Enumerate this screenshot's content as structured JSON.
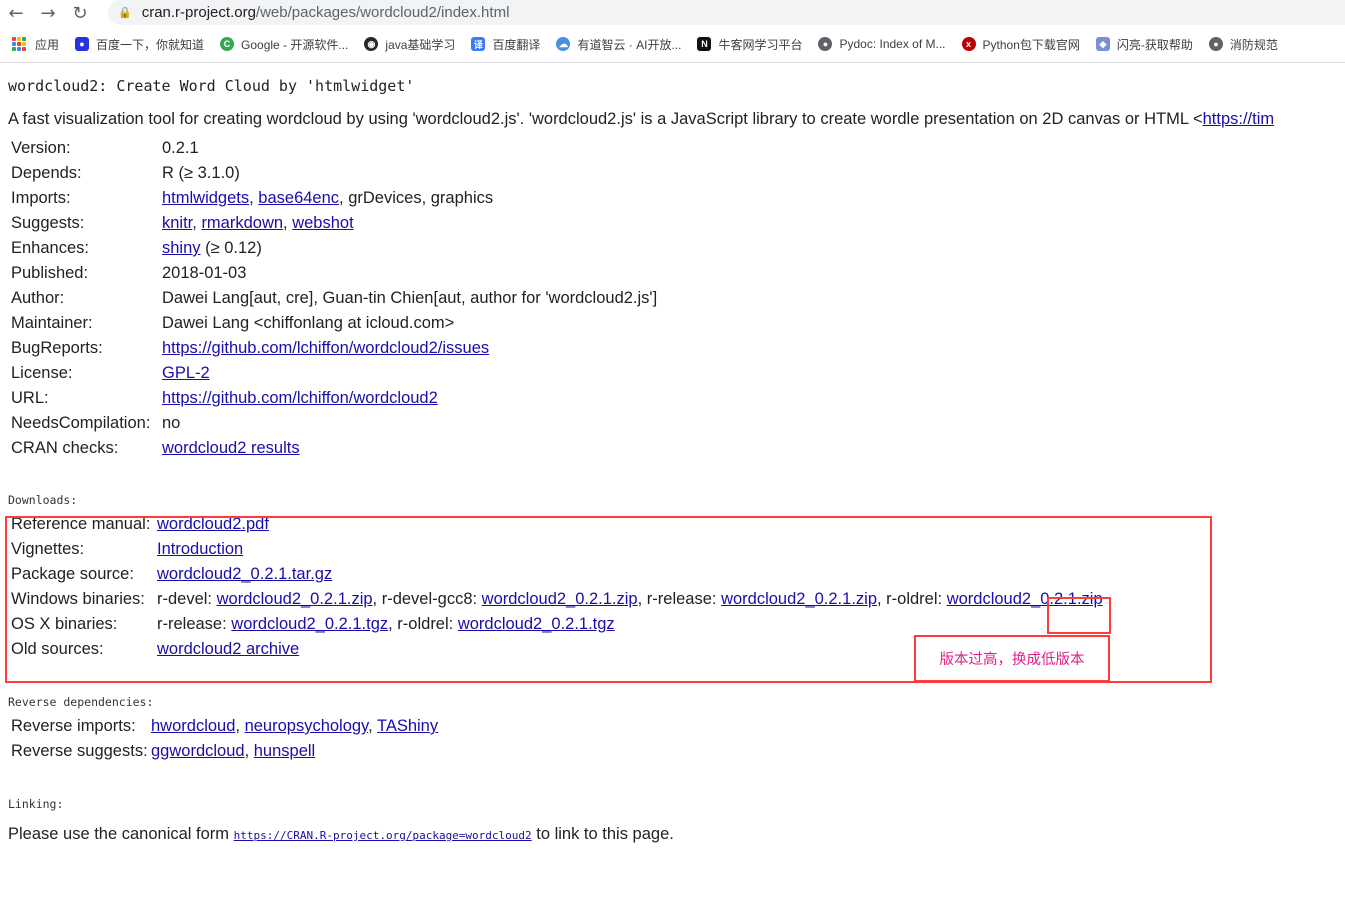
{
  "browser": {
    "url_host": "cran.r-project.org",
    "url_path": "/web/packages/wordcloud2/index.html",
    "bookmarks": [
      {
        "label": "应用",
        "icon": "apps-grid-icon"
      },
      {
        "label": "百度一下，你就知道",
        "icon": "baidu-paw-icon",
        "color": "#2932e1"
      },
      {
        "label": "Google - 开源软件...",
        "icon": "chrome-icon",
        "color": "#34a853"
      },
      {
        "label": "java基础学习",
        "icon": "github-icon",
        "color": "#24292e"
      },
      {
        "label": "百度翻译",
        "icon": "translate-icon",
        "color": "#3d7bf7"
      },
      {
        "label": "有道智云 · AI开放...",
        "icon": "cloud-icon",
        "color": "#4a90e2"
      },
      {
        "label": "牛客网学习平台",
        "icon": "nowcoder-icon",
        "color": "#111111"
      },
      {
        "label": "Pydoc: Index of M...",
        "icon": "globe-icon",
        "color": "#5f6368"
      },
      {
        "label": "Python包下载官网",
        "icon": "python-pkg-icon",
        "color": "#c00000"
      },
      {
        "label": "闪亮-获取帮助",
        "icon": "shiny-icon",
        "color": "#7b8fd6"
      },
      {
        "label": "消防规范",
        "icon": "globe-icon",
        "color": "#5f6368"
      }
    ]
  },
  "page": {
    "title": "wordcloud2: Create Word Cloud by 'htmlwidget'",
    "description_text": "A fast visualization tool for creating wordcloud by using 'wordcloud2.js'. 'wordcloud2.js' is a JavaScript library to create wordle presentation on 2D canvas or HTML <",
    "description_link": "https://tim",
    "meta": {
      "version_label": "Version:",
      "version": "0.2.1",
      "depends_label": "Depends:",
      "depends": "R (≥ 3.1.0)",
      "imports_label": "Imports:",
      "imports_1": "htmlwidgets",
      "imports_2": "base64enc",
      "imports_rest": ", grDevices, graphics",
      "suggests_label": "Suggests:",
      "suggests_1": "knitr",
      "suggests_2": "rmarkdown",
      "suggests_3": "webshot",
      "enhances_label": "Enhances:",
      "enhances_1": "shiny",
      "enhances_rest": " (≥ 0.12)",
      "published_label": "Published:",
      "published": "2018-01-03",
      "author_label": "Author:",
      "author": "Dawei Lang[aut, cre], Guan-tin Chien[aut, author for 'wordcloud2.js']",
      "maintainer_label": "Maintainer:",
      "maintainer": "Dawei Lang <chiffonlang at icloud.com>",
      "bugreports_label": "BugReports:",
      "bugreports": "https://github.com/lchiffon/wordcloud2/issues",
      "license_label": "License:",
      "license": "GPL-2",
      "url_label": "URL:",
      "url": "https://github.com/lchiffon/wordcloud2",
      "needscomp_label": "NeedsCompilation:",
      "needscomp": "no",
      "checks_label": "CRAN checks:",
      "checks": "wordcloud2 results"
    },
    "downloads_heading": "Downloads:",
    "downloads": {
      "refman_label": "Reference manual:",
      "refman": "wordcloud2.pdf",
      "vignettes_label": "Vignettes:",
      "vignettes": "Introduction",
      "source_label": "Package source:",
      "source": "wordcloud2_0.2.1.tar.gz",
      "win_label": "Windows binaries:",
      "win_devel_label": "r-devel: ",
      "win_devel": "wordcloud2_0.2.1.zip",
      "win_gcc8_label": ", r-devel-gcc8: ",
      "win_gcc8": "wordcloud2_0.2.1.zip",
      "win_release_label": ", r-release: ",
      "win_release": "wordcloud2_0.2.1.zip",
      "win_oldrel_label": ", r-oldrel: ",
      "win_oldrel": "wordcloud2_0.2.1.zip",
      "osx_label": "OS X binaries:",
      "osx_release_label": "r-release: ",
      "osx_release": "wordcloud2_0.2.1.tgz",
      "osx_oldrel_label": ", r-oldrel: ",
      "osx_oldrel": "wordcloud2_0.2.1.tgz",
      "old_label": "Old sources:",
      "old": "wordcloud2 archive"
    },
    "reverse_heading": "Reverse dependencies:",
    "reverse": {
      "imports_label": "Reverse imports:",
      "imports_1": "hwordcloud",
      "imports_2": "neuropsychology",
      "imports_3": "TAShiny",
      "suggests_label": "Reverse suggests:",
      "suggests_1": "ggwordcloud",
      "suggests_2": "hunspell"
    },
    "linking_heading": "Linking:",
    "linking_before": "Please use the canonical form ",
    "linking_url": "https://CRAN.R-project.org/package=wordcloud2",
    "linking_after": " to link to this page."
  },
  "annotation": {
    "note": "版本过高，换成低版本",
    "box_color": "#ff3b3b",
    "note_color": "#e0218a"
  }
}
